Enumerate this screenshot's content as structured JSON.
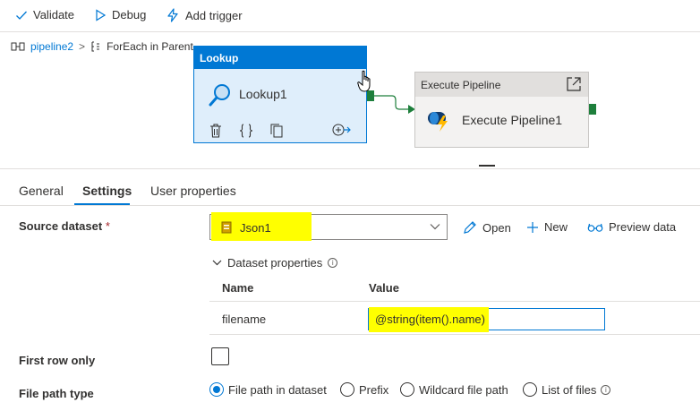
{
  "toolbar": {
    "validate_label": "Validate",
    "debug_label": "Debug",
    "add_trigger_label": "Add trigger"
  },
  "breadcrumb": {
    "pipeline": "pipeline2",
    "separator": ">",
    "activity": "ForEach in Parent"
  },
  "canvas": {
    "lookup_node": {
      "header": "Lookup",
      "name": "Lookup1"
    },
    "execute_node": {
      "header": "Execute Pipeline",
      "name": "Execute Pipeline1"
    }
  },
  "tabs": [
    {
      "label": "General"
    },
    {
      "label": "Settings",
      "active": true
    },
    {
      "label": "User properties"
    }
  ],
  "settings": {
    "source_dataset_label": "Source dataset",
    "required_marker": "*",
    "source_dataset_value": "Json1",
    "open_label": "Open",
    "new_label": "New",
    "preview_label": "Preview data",
    "dataset_properties_label": "Dataset properties",
    "columns": {
      "name": "Name",
      "value": "Value"
    },
    "property_name": "filename",
    "property_value": "@string(item().name)",
    "first_row_only_label": "First row only",
    "file_path_type_label": "File path type",
    "path_options": [
      {
        "label": "File path in dataset",
        "checked": true
      },
      {
        "label": "Prefix",
        "checked": false
      },
      {
        "label": "Wildcard file path",
        "checked": false
      },
      {
        "label": "List of files",
        "checked": false
      }
    ]
  },
  "colors": {
    "accent": "#0078d4",
    "highlight": "#ffff00",
    "port_green": "#1e7f3c"
  }
}
